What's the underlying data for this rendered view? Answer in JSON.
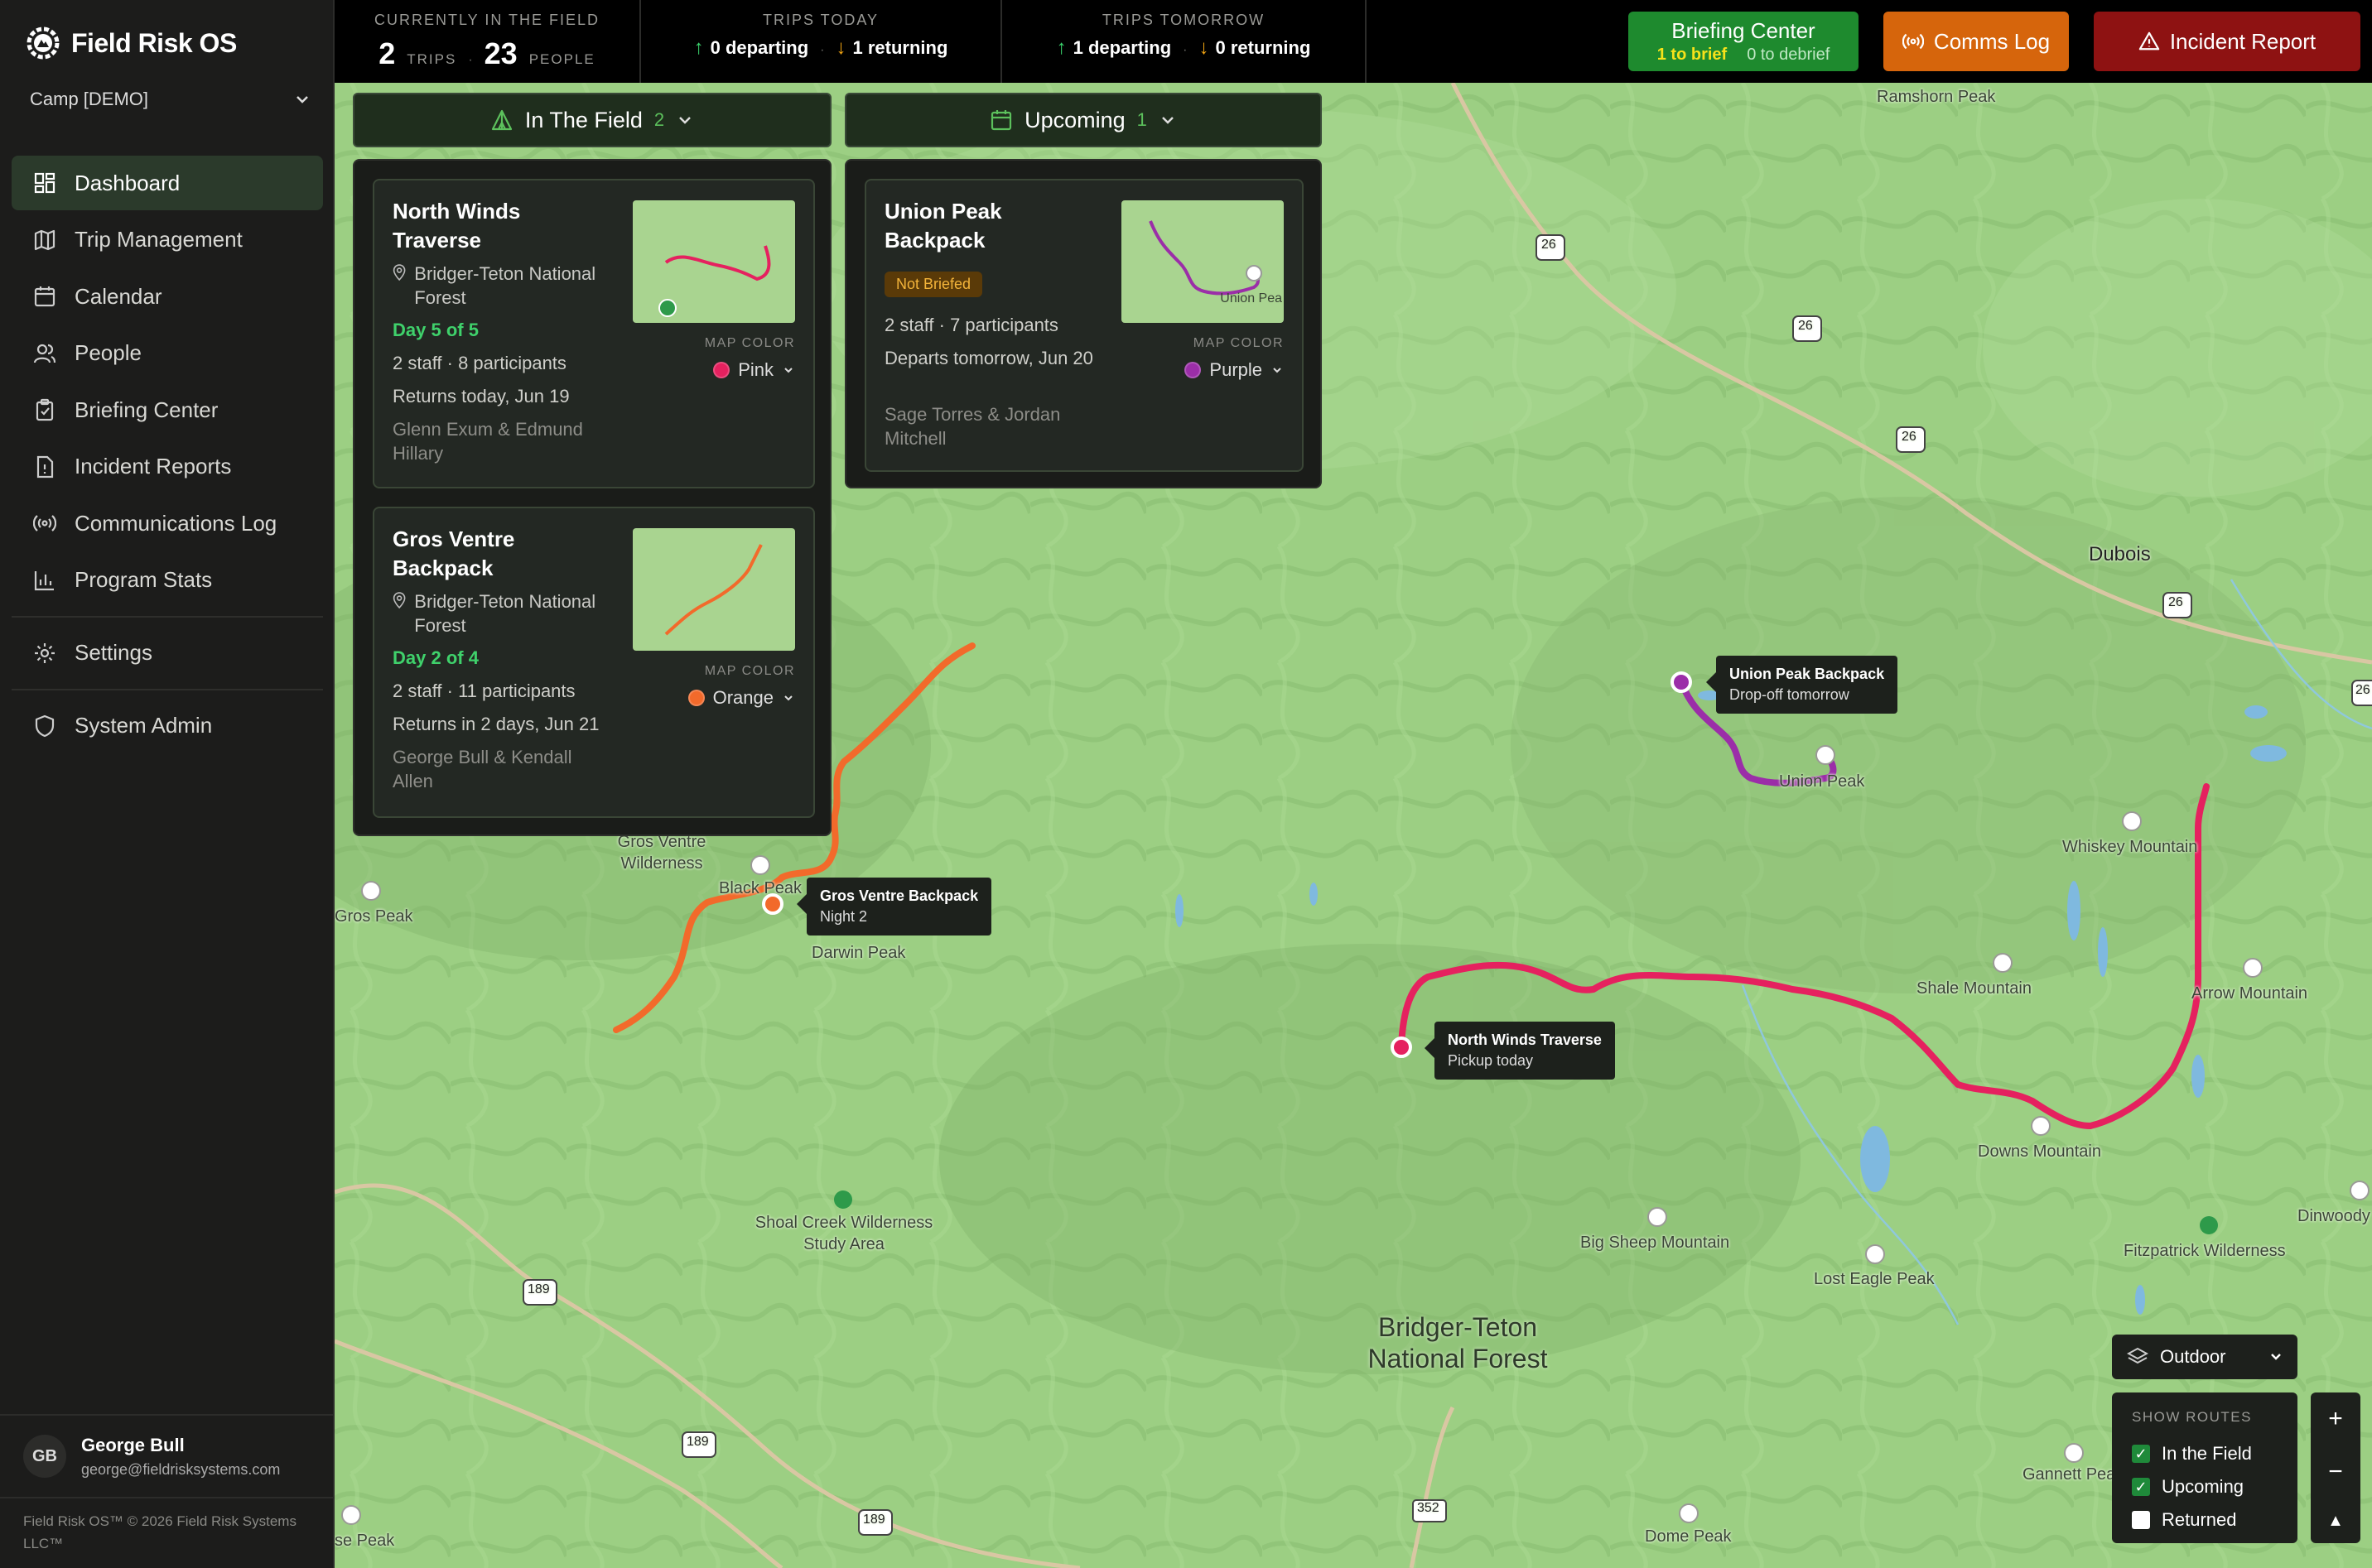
{
  "app": {
    "name": "Field Risk OS",
    "camp": "Camp [DEMO]"
  },
  "nav": [
    {
      "label": "Dashboard",
      "icon": "dashboard-icon"
    },
    {
      "label": "Trip Management",
      "icon": "map-icon"
    },
    {
      "label": "Calendar",
      "icon": "calendar-icon"
    },
    {
      "label": "People",
      "icon": "people-icon"
    },
    {
      "label": "Briefing Center",
      "icon": "clipboard-icon"
    },
    {
      "label": "Incident Reports",
      "icon": "report-icon"
    },
    {
      "label": "Communications Log",
      "icon": "broadcast-icon"
    },
    {
      "label": "Program Stats",
      "icon": "bar-chart-icon"
    },
    {
      "label": "Settings",
      "icon": "gear-icon"
    },
    {
      "label": "System Admin",
      "icon": "shield-icon"
    }
  ],
  "user": {
    "initials": "GB",
    "name": "George Bull",
    "email": "george@fieldrisksystems.com"
  },
  "footer": "Field Risk OS™ © 2026 Field Risk Systems LLC™",
  "stats": {
    "field": {
      "title": "CURRENTLY IN THE FIELD",
      "trips": "2",
      "trips_label": "TRIPS",
      "people": "23",
      "people_label": "PEOPLE"
    },
    "today": {
      "title": "TRIPS TODAY",
      "departing": "0 departing",
      "returning": "1 returning"
    },
    "tomorrow": {
      "title": "TRIPS TOMORROW",
      "departing": "1 departing",
      "returning": "0 returning"
    }
  },
  "buttons": {
    "briefing": {
      "label": "Briefing Center",
      "to_brief": "1 to brief",
      "to_debrief": "0 to debrief"
    },
    "comms": "Comms Log",
    "incident": "Incident Report"
  },
  "panels": {
    "in_field": {
      "label": "In The Field",
      "count": "2"
    },
    "upcoming": {
      "label": "Upcoming",
      "count": "1"
    }
  },
  "trips": [
    {
      "title": "North Winds Traverse",
      "location": "Bridger-Teton National Forest",
      "day": "Day 5 of 5",
      "staff": "2 staff · 8 participants",
      "returns": "Returns today, Jun 19",
      "leaders": "Glenn Exum & Edmund Hillary",
      "map_color_label": "MAP COLOR",
      "map_color": "Pink",
      "color": "#e5215f"
    },
    {
      "title": "Gros Ventre Backpack",
      "location": "Bridger-Teton National Forest",
      "day": "Day 2 of 4",
      "staff": "2 staff · 11 participants",
      "returns": "Returns in 2 days, Jun 21",
      "leaders": "George Bull & Kendall Allen",
      "map_color_label": "MAP COLOR",
      "map_color": "Orange",
      "color": "#f26a2b"
    },
    {
      "title": "Union Peak Backpack",
      "badge": "Not Briefed",
      "staff": "2 staff · 7 participants",
      "departs": "Departs tomorrow, Jun 20",
      "leaders": "Sage Torres & Jordan Mitchell",
      "map_color_label": "MAP COLOR",
      "map_color": "Purple",
      "color": "#9b2ea8",
      "thumb_label": "Union Pea"
    }
  ],
  "tooltips": {
    "union": {
      "title": "Union Peak Backpack",
      "sub": "Drop-off tomorrow"
    },
    "gros": {
      "title": "Gros Ventre Backpack",
      "sub": "Night 2"
    },
    "north": {
      "title": "North Winds Traverse",
      "sub": "Pickup today"
    }
  },
  "map_labels": {
    "ramshorn": "Ramshorn Peak",
    "dubois": "Dubois",
    "union_peak": "Union Peak",
    "whiskey": "Whiskey Mountain",
    "shale": "Shale Mountain",
    "arrow": "Arrow Mountain",
    "downs": "Downs Mountain",
    "dinwoody": "Dinwoody",
    "fitzpatrick": "Fitzpatrick Wilderness",
    "big_sheep": "Big Sheep Mountain",
    "lost_eagle": "Lost Eagle Peak",
    "gannett": "Gannett Pea",
    "dome": "Dome Peak",
    "gros_wild": "Gros Ventre Wilderness",
    "black_peak": "Black Peak",
    "darwin": "Darwin Peak",
    "gros_peak": "Gros Peak",
    "shoal": "Shoal Creek Wilderness Study Area",
    "bridger": "Bridger-Teton National Forest",
    "rose_peak": "se Peak",
    "hwy26": "26",
    "hwy189": "189",
    "hwy352": "352"
  },
  "map_controls": {
    "style": "Outdoor",
    "routes_title": "SHOW ROUTES",
    "routes": [
      {
        "label": "In the Field",
        "checked": true
      },
      {
        "label": "Upcoming",
        "checked": true
      },
      {
        "label": "Returned",
        "checked": false
      }
    ],
    "zoom_in": "+",
    "zoom_out": "−",
    "compass": "▲"
  }
}
